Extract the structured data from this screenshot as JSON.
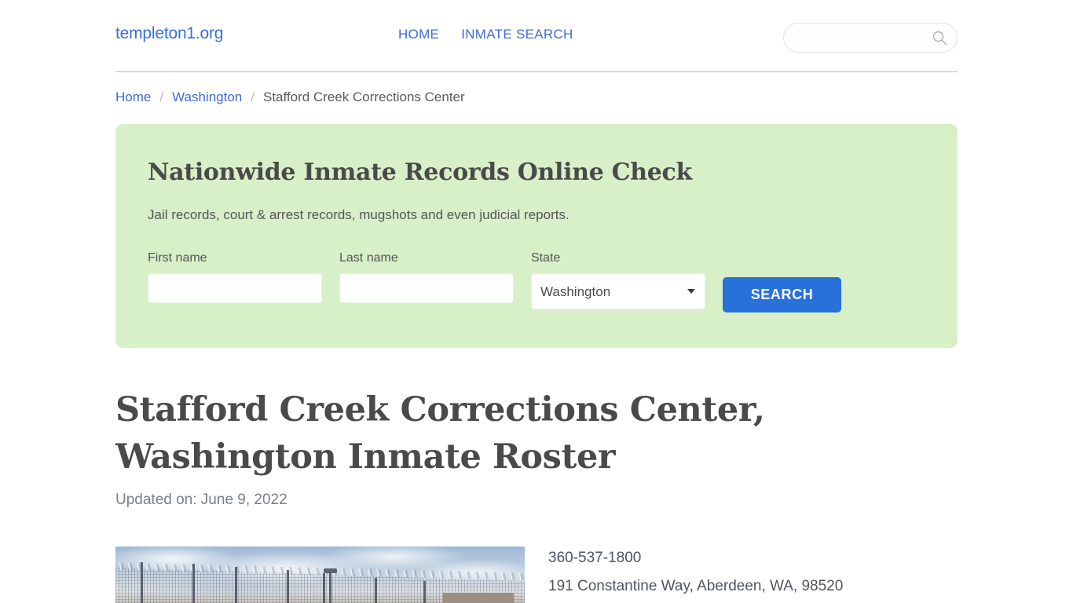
{
  "header": {
    "logo": "templeton1.org",
    "nav": [
      {
        "label": "HOME",
        "name": "nav-home"
      },
      {
        "label": "INMATE SEARCH",
        "name": "nav-inmate-search"
      }
    ],
    "search": {
      "value": "",
      "placeholder": "",
      "icon": "search-icon"
    }
  },
  "breadcrumb": {
    "items": [
      {
        "label": "Home",
        "link": true
      },
      {
        "label": "Washington",
        "link": true
      },
      {
        "label": "Stafford Creek Corrections Center",
        "link": false
      }
    ],
    "separator": "/"
  },
  "search_panel": {
    "title": "Nationwide Inmate Records Online Check",
    "subtitle": "Jail records, court & arrest records, mugshots and even judicial reports.",
    "fields": {
      "first_name": {
        "label": "First name",
        "value": "",
        "placeholder": ""
      },
      "last_name": {
        "label": "Last name",
        "value": "",
        "placeholder": ""
      },
      "state": {
        "label": "State",
        "value": "Washington",
        "options": [
          "Washington"
        ]
      }
    },
    "submit_label": "SEARCH",
    "accent_color": "#2871db",
    "panel_color": "#d7f0c8"
  },
  "main": {
    "title": "Stafford Creek Corrections Center, Washington Inmate Roster",
    "updated_on": "Updated on: June 9, 2022",
    "photo_alt": "prison-fence-photo",
    "contact": {
      "phone": "360-537-1800",
      "address": "191 Constantine Way, Aberdeen, WA, 98520"
    }
  }
}
